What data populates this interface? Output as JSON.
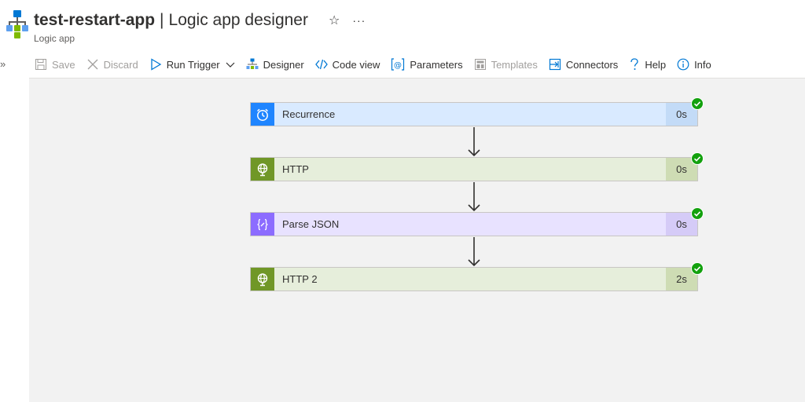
{
  "header": {
    "title": "test-restart-app",
    "separator": "|",
    "subtitle": "Logic app designer",
    "resource_type": "Logic app",
    "favorite_icon": "star-icon",
    "more_icon": "ellipsis-icon"
  },
  "nav": {
    "expand_icon": "chevron-double-right-icon"
  },
  "toolbar": {
    "save": "Save",
    "discard": "Discard",
    "run_trigger": "Run Trigger",
    "designer": "Designer",
    "code_view": "Code view",
    "parameters": "Parameters",
    "templates": "Templates",
    "connectors": "Connectors",
    "help": "Help",
    "info": "Info"
  },
  "steps": [
    {
      "label": "Recurrence",
      "duration": "0s",
      "icon": "clock-icon",
      "status": "succeeded",
      "accent": "#1f85ff",
      "body": "#d9eaff",
      "duration_bg": "#c3dbf7"
    },
    {
      "label": "HTTP",
      "duration": "0s",
      "icon": "globe-icon",
      "status": "succeeded",
      "accent": "#709727",
      "body": "#e6eedb",
      "duration_bg": "#cedcb4"
    },
    {
      "label": "Parse JSON",
      "duration": "0s",
      "icon": "json-braces-icon",
      "status": "succeeded",
      "accent": "#8c6cff",
      "body": "#e8e2ff",
      "duration_bg": "#d5cbf7"
    },
    {
      "label": "HTTP 2",
      "duration": "2s",
      "icon": "globe-icon",
      "status": "succeeded",
      "accent": "#709727",
      "body": "#e6eedb",
      "duration_bg": "#cedcb4"
    }
  ],
  "colors": {
    "success": "#13a10e",
    "accent": "#0078d4",
    "canvas": "#f2f2f2"
  }
}
